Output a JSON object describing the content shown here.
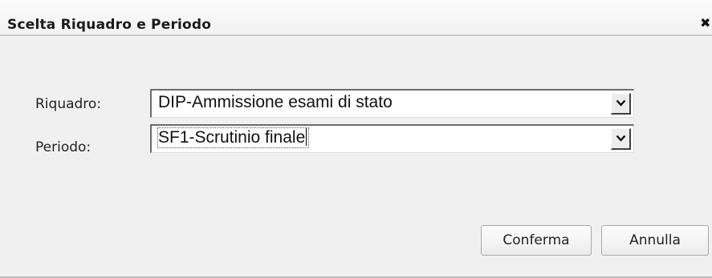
{
  "dialog": {
    "title": "Scelta Riquadro e Periodo",
    "close_glyph": "✖"
  },
  "form": {
    "riquadro": {
      "label": "Riquadro:",
      "selected": "DIP-Ammissione esami di stato"
    },
    "periodo": {
      "label": "Periodo:",
      "selected": "SF1-Scrutinio finale"
    }
  },
  "buttons": {
    "confirm_label": "Conferma",
    "cancel_label": "Annulla"
  },
  "icons": {
    "close": "close-icon",
    "dropdown": "chevron-down-icon"
  },
  "colors": {
    "titlebar_bg": "#f5f5f5",
    "dialog_bg": "#f0f0f0",
    "field_bg": "#ffffff"
  }
}
